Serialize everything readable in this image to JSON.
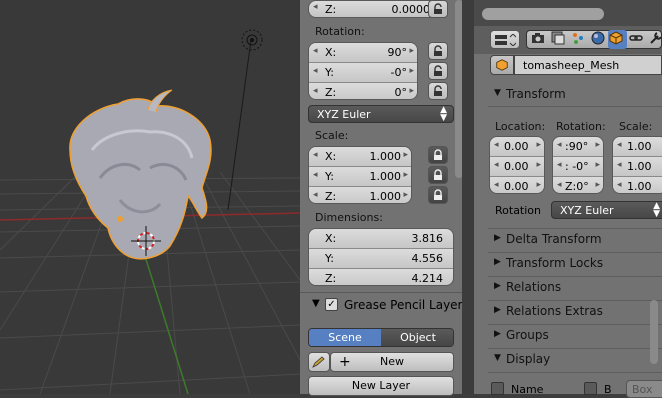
{
  "npanel": {
    "z_top": {
      "key": "Z:",
      "value": "0.00000"
    },
    "rotation_label": "Rotation:",
    "rotation": [
      {
        "key": "X:",
        "value": "90°"
      },
      {
        "key": "Y:",
        "value": "-0°"
      },
      {
        "key": "Z:",
        "value": "0°"
      }
    ],
    "rotation_mode": "XYZ Euler",
    "scale_label": "Scale:",
    "scale": [
      {
        "key": "X:",
        "value": "1.000"
      },
      {
        "key": "Y:",
        "value": "1.000"
      },
      {
        "key": "Z:",
        "value": "1.000"
      }
    ],
    "dimensions_label": "Dimensions:",
    "dimensions": [
      {
        "key": "X:",
        "value": "3.816"
      },
      {
        "key": "Y:",
        "value": "4.556"
      },
      {
        "key": "Z:",
        "value": "4.214"
      }
    ],
    "grease_pencil_title": "Grease Pencil Layers",
    "gp_scene": "Scene",
    "gp_object": "Object",
    "gp_new": "New",
    "gp_new_layer": "New Layer"
  },
  "properties": {
    "object_name": "tomasheep_Mesh",
    "transform_title": "Transform",
    "location_label": "Location:",
    "rotation_label": "Rotation:",
    "scale_label": "Scale:",
    "location": [
      "0.00",
      "0.00",
      "0.00"
    ],
    "rotation": [
      ":90°",
      ": -0°",
      "Z:0°"
    ],
    "scale": [
      "1.00",
      "1.00",
      "1.00"
    ],
    "rotation_mode_label": "Rotation",
    "rotation_mode": "XYZ Euler",
    "panels": [
      "Delta Transform",
      "Transform Locks",
      "Relations",
      "Relations Extras",
      "Groups"
    ],
    "display_title": "Display",
    "display_name": "Name",
    "display_b": "B",
    "display_box": "Box"
  },
  "colors": {
    "object_outline": "#f0a030",
    "selection_highlight": "#5680c2",
    "viewport_bg": "#393939",
    "panel_bg": "#727272"
  }
}
